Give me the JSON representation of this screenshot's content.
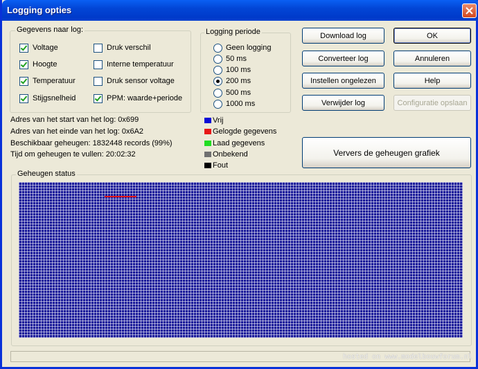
{
  "window": {
    "title": "Logging opties",
    "close_icon": "close-icon"
  },
  "log_group": {
    "label": "Gegevens naar log:",
    "items": [
      {
        "label": "Voltage",
        "checked": true
      },
      {
        "label": "Hoogte",
        "checked": true
      },
      {
        "label": "Temperatuur",
        "checked": true
      },
      {
        "label": "Stijgsnelheid",
        "checked": true
      },
      {
        "label": "Druk verschil",
        "checked": false
      },
      {
        "label": "Interne temperatuur",
        "checked": false
      },
      {
        "label": "Druk sensor voltage",
        "checked": false
      },
      {
        "label": "PPM: waarde+periode",
        "checked": true
      }
    ]
  },
  "period_group": {
    "label": "Logging periode",
    "options": [
      {
        "label": "Geen logging",
        "selected": false
      },
      {
        "label": "50 ms",
        "selected": false
      },
      {
        "label": "100 ms",
        "selected": false
      },
      {
        "label": "200 ms",
        "selected": true
      },
      {
        "label": "500 ms",
        "selected": false
      },
      {
        "label": "1000 ms",
        "selected": false
      }
    ]
  },
  "buttons": {
    "download": "Download log",
    "ok": "OK",
    "convert": "Converteer log",
    "cancel": "Annuleren",
    "set_unread": "Instellen ongelezen",
    "help": "Help",
    "delete": "Verwijder log",
    "save_config": "Configuratie opslaan",
    "refresh": "Ververs de geheugen grafiek"
  },
  "info": {
    "start": "Adres van het start van het log: 0x699",
    "end": "Adres van het einde van het log: 0x6A2",
    "available": "Beschikbaar geheugen: 1832448 records (99%)",
    "time": "Tijd om geheugen te vullen: 20:02:32"
  },
  "legend": [
    {
      "label": "Vrij",
      "color": "#0a0ad6"
    },
    {
      "label": "Gelogde gegevens",
      "color": "#e81616"
    },
    {
      "label": "Laad gegevens",
      "color": "#22dd22"
    },
    {
      "label": "Onbekend",
      "color": "#707070"
    },
    {
      "label": "Fout",
      "color": "#000000"
    }
  ],
  "memory": {
    "label": "Geheugen status"
  },
  "watermark": "hosted on www.modelbouwforum.nl"
}
